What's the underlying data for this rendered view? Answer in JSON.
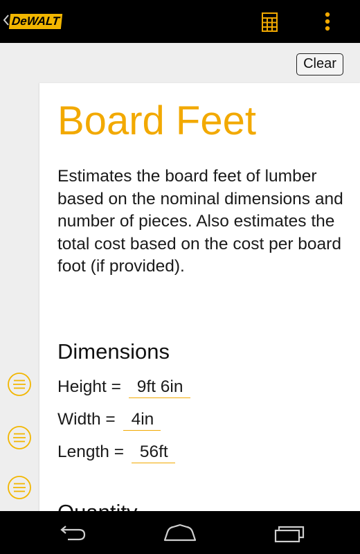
{
  "app_bar": {
    "logo_text": "DeWALT",
    "back_icon": "chevron-left-icon",
    "calculator_icon": "calculator-icon",
    "overflow_icon": "overflow-menu-icon"
  },
  "clear_label": "Clear",
  "title": "Board Feet",
  "description": "Estimates the board feet of lumber based on the nominal dimensions and number of pieces. Also estimates the total cost based on the cost per board foot (if provided).",
  "dimensions": {
    "heading": "Dimensions",
    "fields": [
      {
        "label": "Height =",
        "value": "9ft 6in"
      },
      {
        "label": "Width =",
        "value": "4in"
      },
      {
        "label": "Length =",
        "value": "56ft"
      }
    ]
  },
  "next_section_partial": "Quantity",
  "nav_bar": {
    "back_icon": "nav-back-icon",
    "home_icon": "nav-home-icon",
    "recents_icon": "nav-recents-icon"
  },
  "colors": {
    "accent": "#f2a900",
    "logo_yellow": "#f2b600",
    "bar_background": "#000000",
    "page_background": "#eeeeee"
  }
}
